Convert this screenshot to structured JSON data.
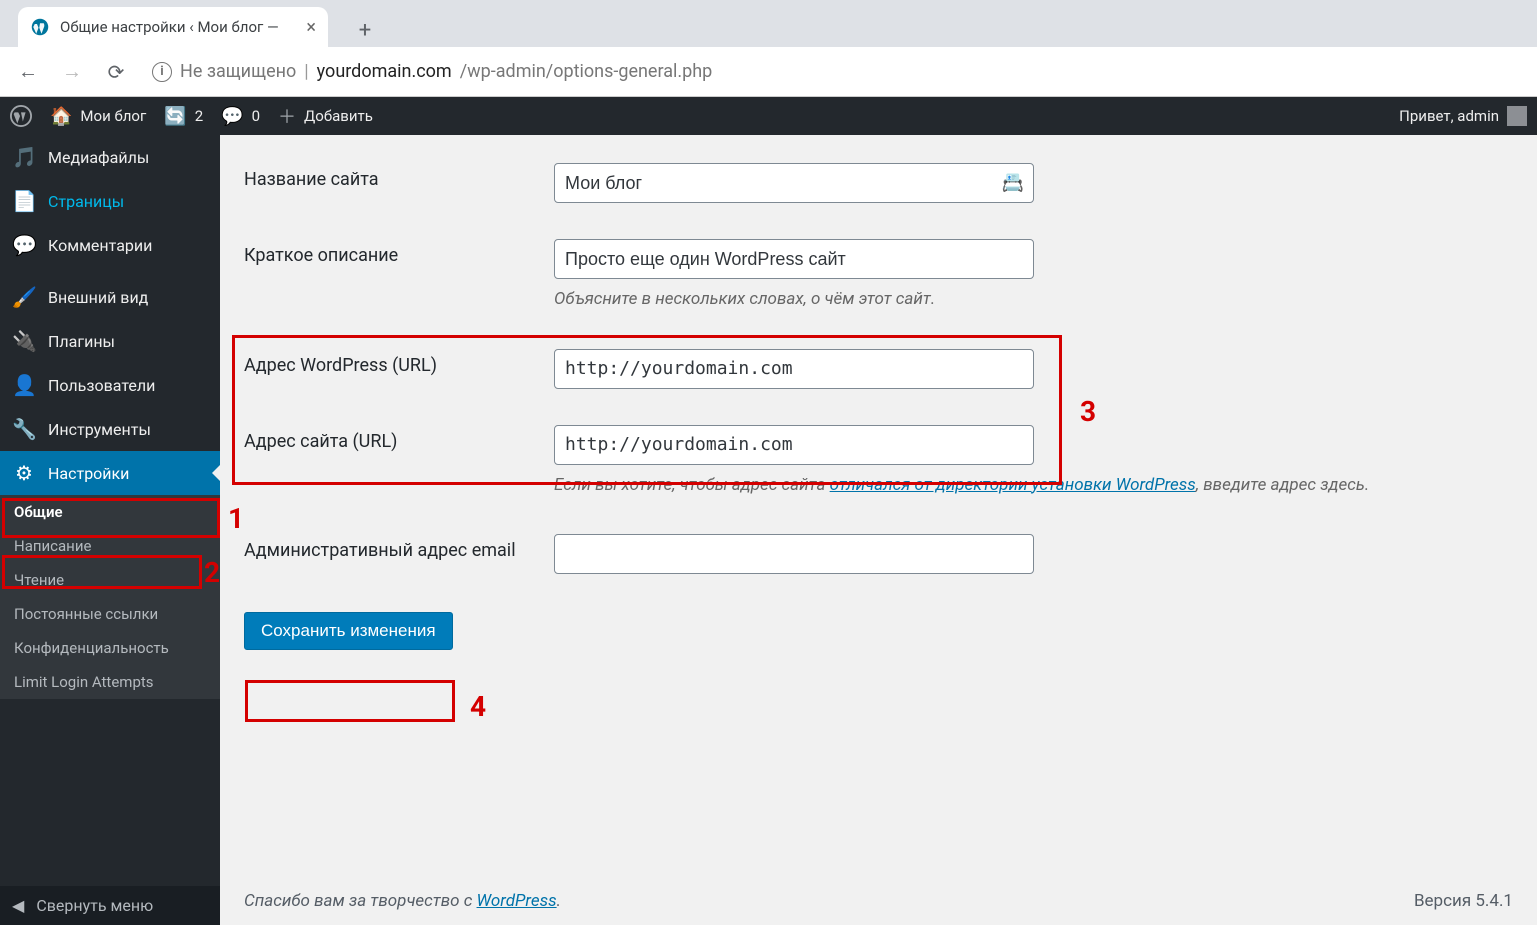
{
  "browser": {
    "tab_title": "Общие настройки ‹ Мои блог —",
    "security_label": "Не защищено",
    "url_domain": "yourdomain.com",
    "url_path": "/wp-admin/options-general.php"
  },
  "adminbar": {
    "site_name": "Мои блог",
    "updates_count": "2",
    "comments_count": "0",
    "new_label": "Добавить",
    "howdy": "Привет, admin"
  },
  "sidebar": {
    "media": "Медиафайлы",
    "pages": "Страницы",
    "comments": "Комментарии",
    "appearance": "Внешний вид",
    "plugins": "Плагины",
    "users": "Пользователи",
    "tools": "Инструменты",
    "settings": "Настройки",
    "sub": {
      "general": "Общие",
      "writing": "Написание",
      "reading": "Чтение",
      "permalinks": "Постоянные ссылки",
      "privacy": "Конфиденциальность",
      "lla": "Limit Login Attempts"
    },
    "collapse": "Свернуть меню"
  },
  "form": {
    "site_title_label": "Название сайта",
    "site_title_value": "Мои блог",
    "tagline_label": "Краткое описание",
    "tagline_value": "Просто еще один WordPress сайт",
    "tagline_desc": "Объясните в нескольких словах, о чём этот сайт.",
    "wp_url_label": "Адрес WordPress (URL)",
    "wp_url_value": "http://yourdomain.com",
    "site_url_label": "Адрес сайта (URL)",
    "site_url_value": "http://yourdomain.com",
    "site_url_desc_1": "Если вы хотите, чтобы адрес сайта ",
    "site_url_desc_link": "отличался от директории установки WordPress",
    "site_url_desc_2": ", введите адрес здесь.",
    "admin_email_label": "Административный адрес email",
    "admin_email_value": "",
    "submit_label": "Сохранить изменения"
  },
  "footer": {
    "thanks_1": "Спасибо вам за творчество с ",
    "thanks_link": "WordPress",
    "thanks_2": ".",
    "version": "Версия 5.4.1"
  },
  "anno": {
    "n1": "1",
    "n2": "2",
    "n3": "3",
    "n4": "4"
  }
}
